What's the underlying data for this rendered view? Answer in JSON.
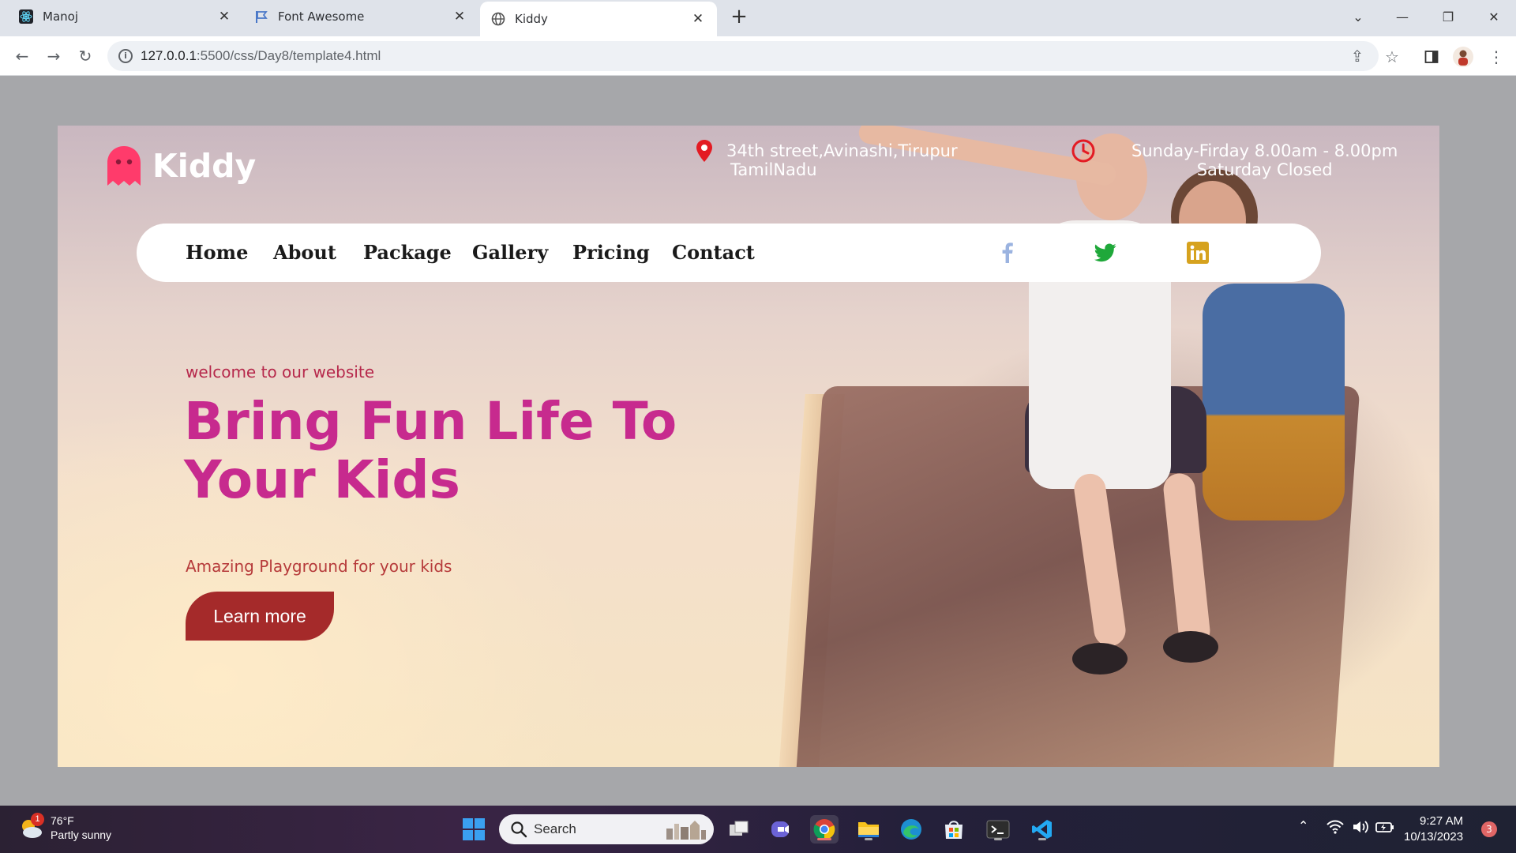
{
  "browser": {
    "tabs": [
      {
        "label": "Manoj",
        "icon": "react-icon",
        "active": false
      },
      {
        "label": "Font Awesome",
        "icon": "flag-icon",
        "active": false
      },
      {
        "label": "Kiddy",
        "icon": "globe-icon",
        "active": true
      }
    ],
    "url_host": "127.0.0.1",
    "url_path": ":5500/css/Day8/template4.html"
  },
  "page": {
    "logo_text": "Kiddy",
    "address_line1": "34th street,Avinashi,Tirupur",
    "address_line2": "TamilNadu",
    "hours_line1": "Sunday-Firday 8.00am - 8.00pm",
    "hours_line2": "Saturday Closed",
    "nav": [
      "Home",
      "About",
      "Package",
      "Gallery",
      "Pricing",
      "Contact"
    ],
    "social": [
      "facebook-icon",
      "twitter-icon",
      "linkedin-icon"
    ],
    "welcome": "welcome to our website",
    "headline_line1": "Bring Fun Life To",
    "headline_line2": "Your Kids",
    "tagline": "Amazing Playground for your kids",
    "cta": "Learn more",
    "colors": {
      "headline": "#c72a8e",
      "accent": "#a52a2a",
      "logo": "#ff3b6b"
    }
  },
  "taskbar": {
    "weather_temp": "76°F",
    "weather_desc": "Partly sunny",
    "weather_badge": "1",
    "search_label": "Search",
    "time": "9:27 AM",
    "date": "10/13/2023",
    "notification_count": "3"
  }
}
